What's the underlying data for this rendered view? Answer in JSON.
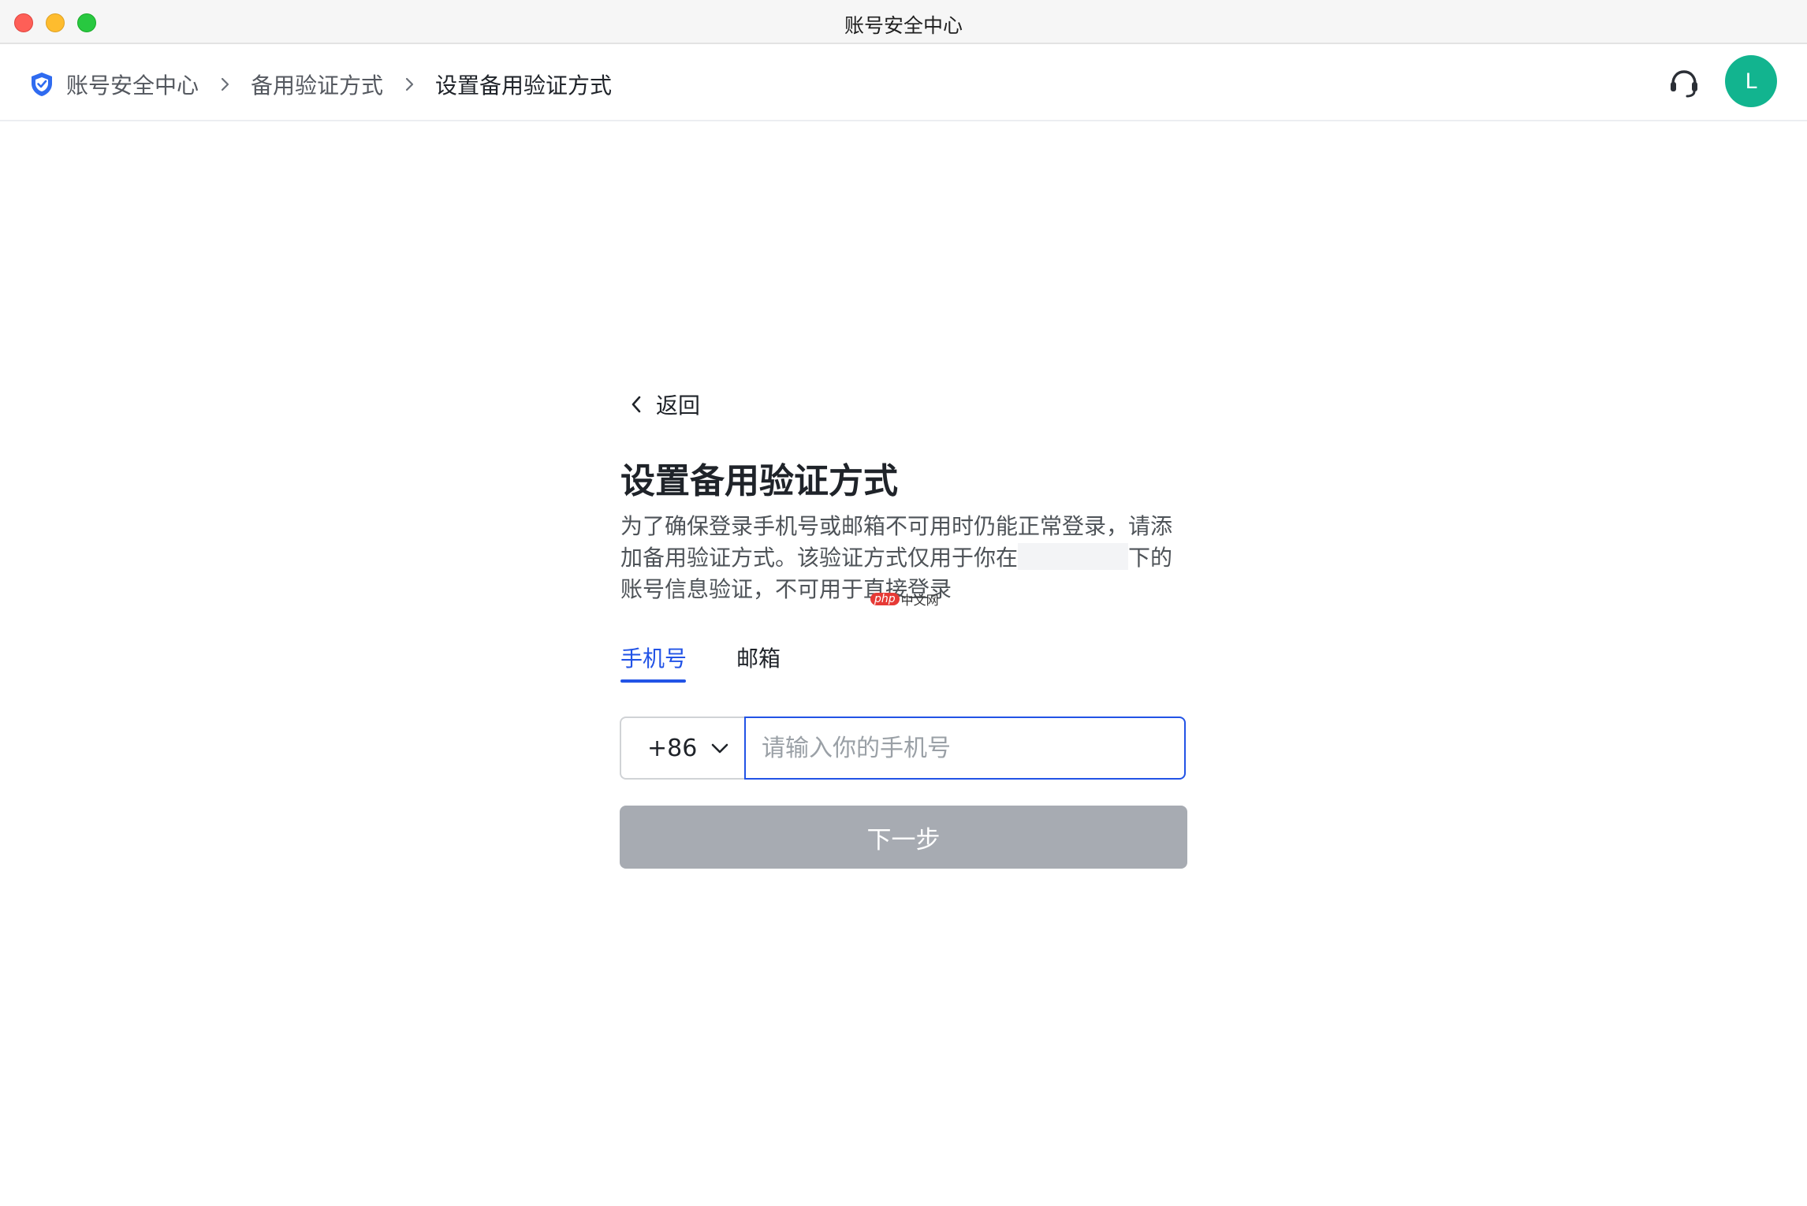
{
  "window": {
    "title": "账号安全中心"
  },
  "header": {
    "breadcrumb": {
      "root": "账号安全中心",
      "middle": "备用验证方式",
      "current": "设置备用验证方式"
    },
    "avatar_initial": "L"
  },
  "main": {
    "back_label": "返回",
    "title": "设置备用验证方式",
    "description_part1": "为了确保登录手机号或邮箱不可用时仍能正常登录，请添加备用验证方式。该验证方式仅用于你在",
    "description_part2": "下的账号信息验证，不可用于直接登录",
    "tabs": [
      {
        "label": "手机号",
        "active": true
      },
      {
        "label": "邮箱",
        "active": false
      }
    ],
    "country_code": "+86",
    "phone_placeholder": "请输入你的手机号",
    "next_label": "下一步"
  },
  "watermark": {
    "badge": "php",
    "text": "中文网"
  },
  "colors": {
    "accent": "#2253e6",
    "avatar": "#12b48f",
    "button_disabled": "#a7abb2"
  },
  "icons": [
    "shield-check-icon",
    "chevron-right-icon",
    "headset-icon",
    "chevron-left-icon",
    "chevron-down-icon"
  ]
}
